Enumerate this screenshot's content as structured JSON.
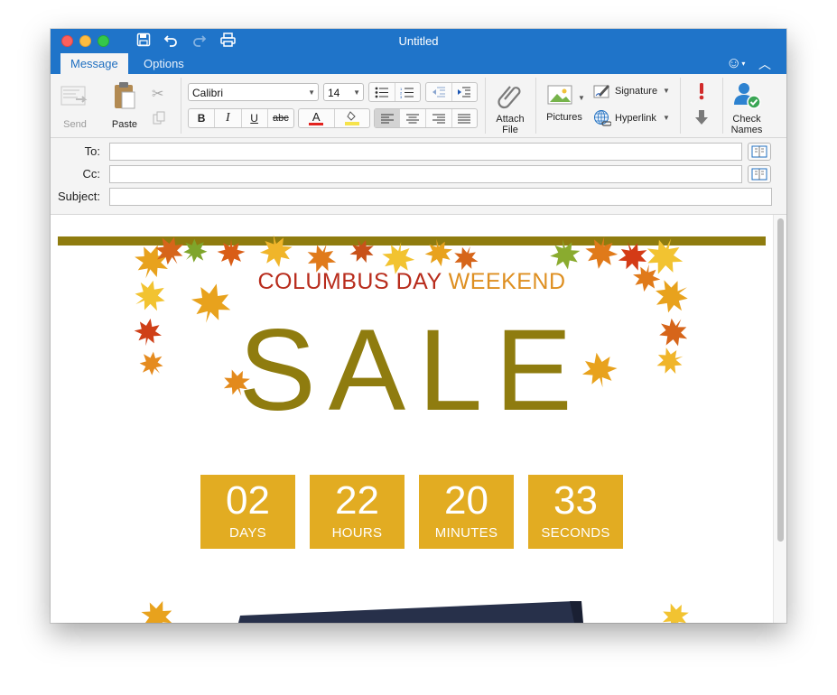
{
  "window": {
    "title": "Untitled"
  },
  "tabs": [
    {
      "label": "Message"
    },
    {
      "label": "Options"
    }
  ],
  "ribbon": {
    "send_label": "Send",
    "paste_label": "Paste",
    "font_name": "Calibri",
    "font_size": "14",
    "attach_label_1": "Attach",
    "attach_label_2": "File",
    "pictures_label": "Pictures",
    "signature_label": "Signature",
    "hyperlink_label": "Hyperlink",
    "check_names_label_1": "Check",
    "check_names_label_2": "Names",
    "format_buttons": {
      "bold": "B",
      "italic": "I",
      "underline": "U",
      "strike": "abc"
    },
    "font_color_glyph": "A"
  },
  "address": {
    "to_label": "To:",
    "cc_label": "Cc:",
    "subject_label": "Subject:"
  },
  "email": {
    "headline_part1": "COLUMBUS DAY",
    "headline_part2": "WEEKEND",
    "sale_text": "SALE",
    "countdown": [
      {
        "value": "02",
        "unit": "DAYS"
      },
      {
        "value": "22",
        "unit": "HOURS"
      },
      {
        "value": "20",
        "unit": "MINUTES"
      },
      {
        "value": "33",
        "unit": "SECONDS"
      }
    ]
  },
  "colors": {
    "titlebar": "#1f74c9",
    "olive": "#8f7c0f",
    "countdown_bg": "#e2ac22",
    "headline_red": "#b82c1c",
    "headline_orange": "#de8f21"
  }
}
